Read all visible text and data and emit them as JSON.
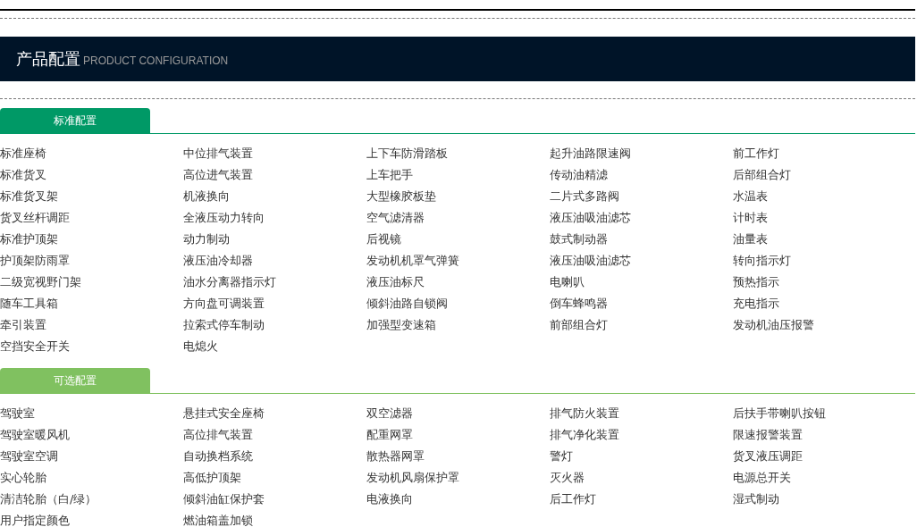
{
  "header": {
    "title": "产品配置",
    "subtitle": "PRODUCT CONFIGURATION"
  },
  "sections": [
    {
      "tab": "标准配置",
      "color": "#009966",
      "items": [
        "标准座椅",
        "中位排气装置",
        "上下车防滑踏板",
        "起升油路限速阀",
        "前工作灯",
        "标准货叉",
        "高位进气装置",
        "上车把手",
        "传动油精滤",
        "后部组合灯",
        "标准货叉架",
        "机液换向",
        "大型橡胶板垫",
        "二片式多路阀",
        "水温表",
        "货叉丝杆调距",
        "全液压动力转向",
        "空气滤清器",
        "液压油吸油滤芯",
        "计时表",
        "标准护顶架",
        "动力制动",
        "后视镜",
        "鼓式制动器",
        "油量表",
        "护顶架防雨罩",
        "液压油冷却器",
        "发动机机罩气弹簧",
        "液压油吸油滤芯",
        "转向指示灯",
        "二级宽视野门架",
        "油水分离器指示灯",
        "液压油标尺",
        "电喇叭",
        "预热指示",
        "随车工具箱",
        "方向盘可调装置",
        "倾斜油路自锁阀",
        "倒车蜂鸣器",
        "充电指示",
        "牵引装置",
        "拉索式停车制动",
        "加强型变速箱",
        "前部组合灯",
        "发动机油压报警",
        "空挡安全开关",
        "电熄火"
      ]
    },
    {
      "tab": "可选配置",
      "color": "#80c160",
      "items": [
        "驾驶室",
        "悬挂式安全座椅",
        "双空滤器",
        "排气防火装置",
        "后扶手带喇叭按钮",
        "驾驶室暖风机",
        "高位排气装置",
        "配重网罩",
        "排气净化装置",
        "限速报警装置",
        "驾驶室空调",
        "自动换档系统",
        "散热器网罩",
        "警灯",
        "货叉液压调距",
        "实心轮胎",
        "高低护顶架",
        "发动机风扇保护罩",
        "灭火器",
        "电源总开关",
        "清洁轮胎（白/绿）",
        "倾斜油缸保护套",
        "电液换向",
        "后工作灯",
        "湿式制动",
        "用户指定颜色",
        "燃油箱盖加锁"
      ]
    }
  ]
}
